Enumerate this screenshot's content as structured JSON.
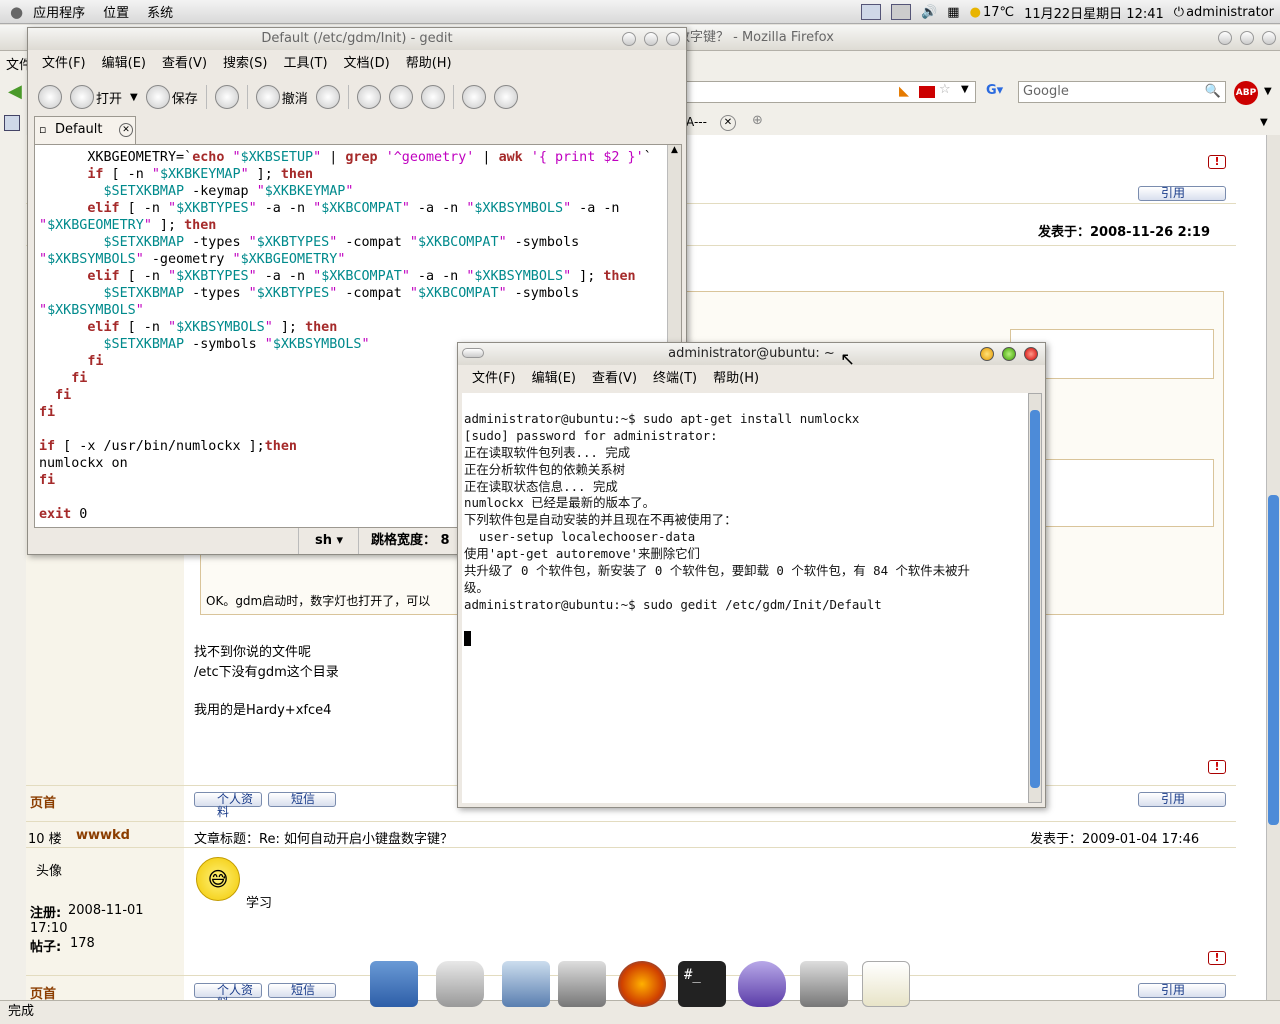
{
  "top_panel": {
    "menu_apps": "应用程序",
    "menu_places": "位置",
    "menu_system": "系统",
    "weather": "17℃",
    "datetime": "11月22日星期日 12:41",
    "user": "administrator"
  },
  "firefox": {
    "title": "如何自动开启小键盘数字键？ - Mozilla Firefox",
    "menu_file_partial": "文件",
    "search_placeholder": "Google",
    "abp": "ABP",
    "tab_partial": "A---",
    "posted_label": "发表于：2008-11-26 2:19",
    "quote_label": "引用",
    "reply_ok": "OK。gdm启动时，数字灯也打开了，可以",
    "reply_lines": [
      "找不到你说的文件呢",
      "/etc下没有gdm这个目录",
      "",
      "我用的是Hardy+xfce4"
    ],
    "top_link": "页首",
    "profile_btn": "个人资料",
    "pm_btn": "短信",
    "post10": {
      "floor": "10 楼",
      "author": "wwwkd",
      "subject": "文章标题：Re: 如何自动开启小键盘数字键？",
      "posted": "发表于：2009-01-04 17:46",
      "avatar_label": "头像",
      "reg_label": "注册:",
      "reg_value": "2008-11-01 17:10",
      "posts_label": "帖子:",
      "posts_value": "178",
      "body": "学习"
    },
    "status": "完成"
  },
  "gedit": {
    "title": "Default (/etc/gdm/Init) - gedit",
    "menu": [
      "文件(F)",
      "编辑(E)",
      "查看(V)",
      "搜索(S)",
      "工具(T)",
      "文档(D)",
      "帮助(H)"
    ],
    "toolbar": {
      "open": "打开",
      "save": "保存",
      "undo": "撤消"
    },
    "tab": "Default",
    "lang": "sh",
    "tab_width": "跳格宽度：  8"
  },
  "terminal": {
    "title": "administrator@ubuntu: ~",
    "menu": [
      "文件(F)",
      "编辑(E)",
      "查看(V)",
      "终端(T)",
      "帮助(H)"
    ],
    "lines": [
      "administrator@ubuntu:~$ sudo apt-get install numlockx",
      "[sudo] password for administrator:",
      "正在读取软件包列表... 完成",
      "正在分析软件包的依赖关系树",
      "正在读取状态信息... 完成",
      "numlockx 已经是最新的版本了。",
      "下列软件包是自动安装的并且现在不再被使用了：",
      "  user-setup localechooser-data",
      "使用'apt-get autoremove'来删除它们",
      "共升级了 0 个软件包，新安装了 0 个软件包，要卸载 0 个软件包，有 84 个软件未被升",
      "级。",
      "administrator@ubuntu:~$ sudo gedit /etc/gdm/Init/Default"
    ]
  },
  "dock": [
    "desktop-icon",
    "trash-icon",
    "home-icon",
    "file-manager-icon",
    "firefox-icon",
    "terminal-icon",
    "pidgin-icon",
    "file-cabinet-icon",
    "text-editor-icon"
  ]
}
